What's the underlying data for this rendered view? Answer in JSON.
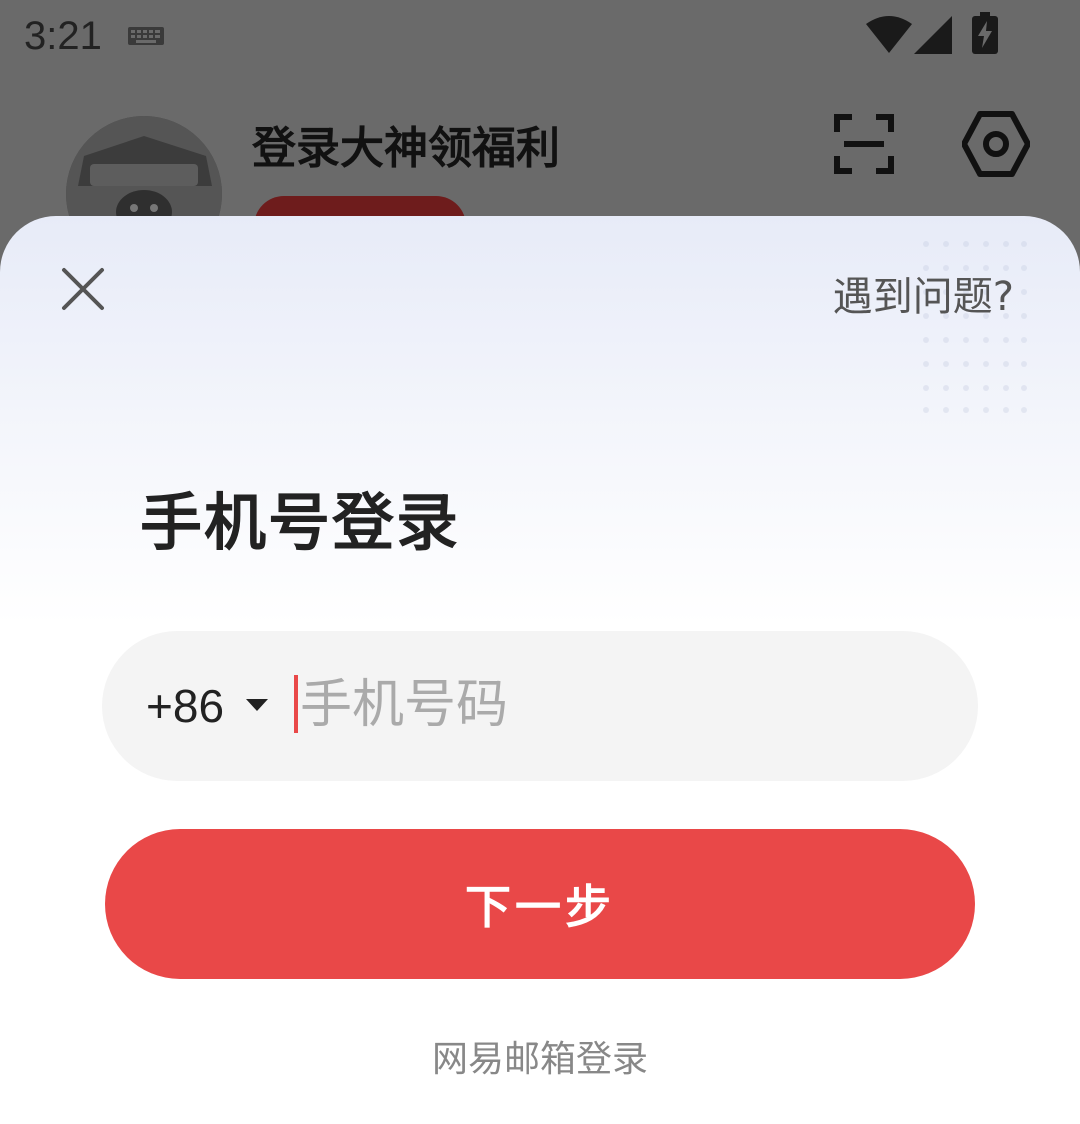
{
  "status_bar": {
    "time": "3:21",
    "icons": [
      "keyboard-icon",
      "wifi-icon",
      "signal-icon",
      "battery-charging-icon"
    ]
  },
  "profile_header": {
    "title": "登录大神领福利",
    "icons": [
      "avatar",
      "scan-icon",
      "settings-icon"
    ]
  },
  "login_sheet": {
    "help_label": "遇到问题?",
    "title": "手机号登录",
    "country_code": "+86",
    "phone_placeholder": "手机号码",
    "phone_value": "",
    "next_label": "下一步",
    "email_login_label": "网易邮箱登录"
  },
  "colors": {
    "accent": "#e94848",
    "input_bg": "#f4f4f4",
    "overlay": "#6a6a6a"
  }
}
